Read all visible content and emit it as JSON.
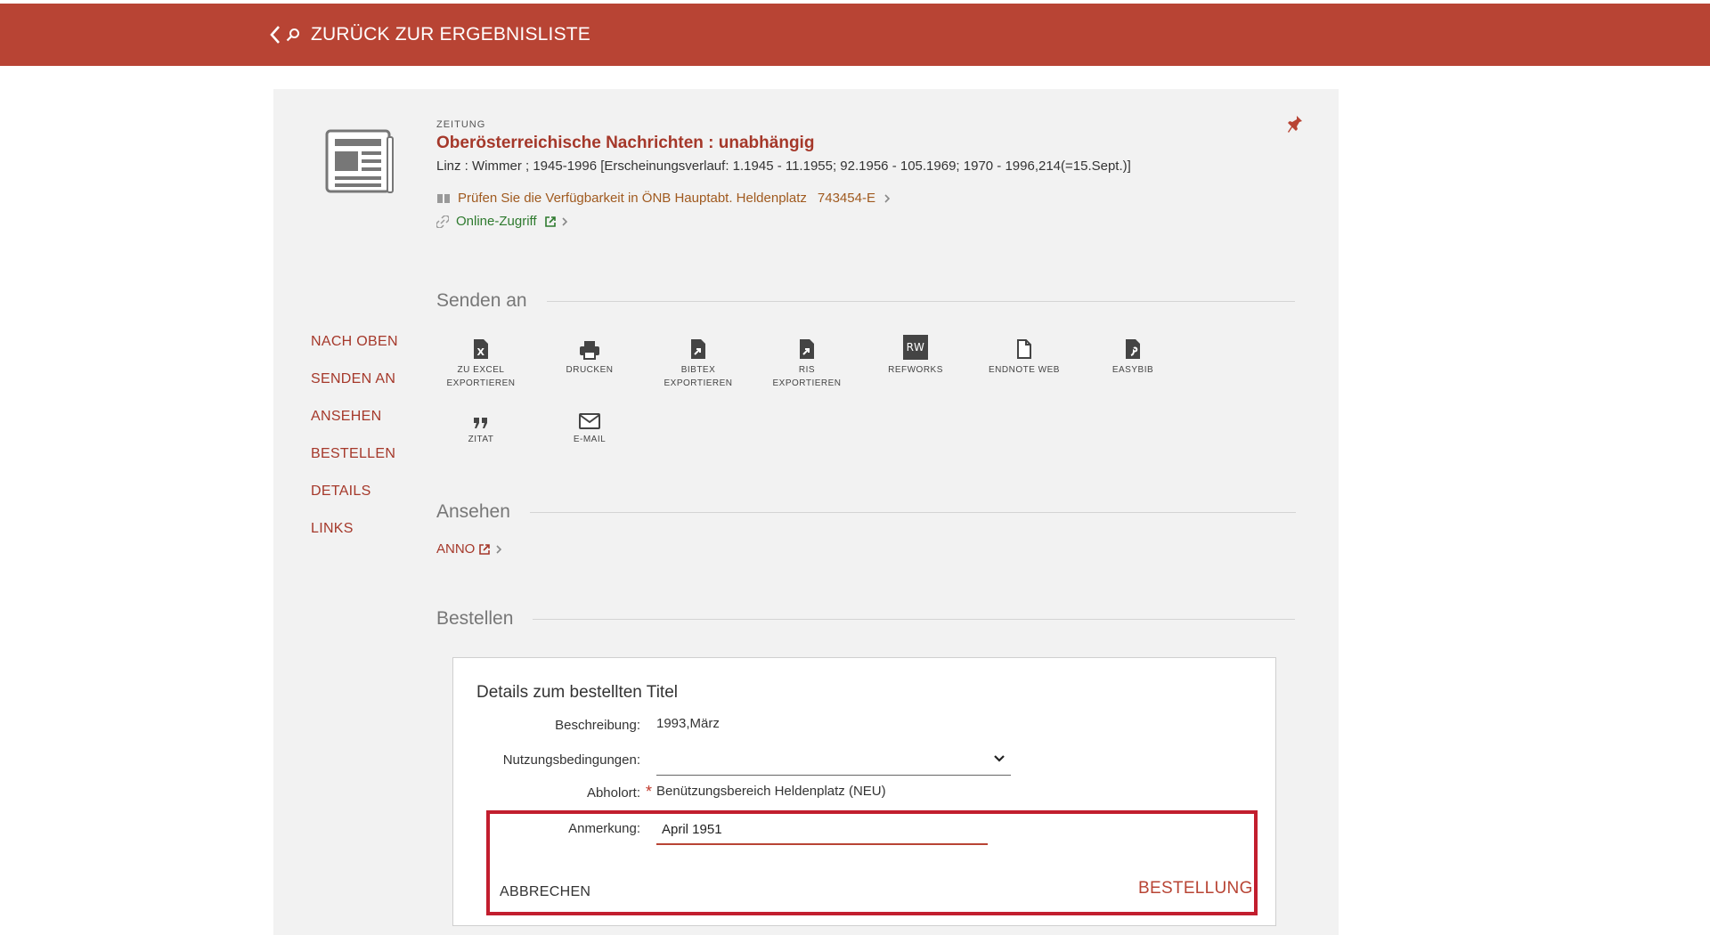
{
  "topbar": {
    "back_label": "ZURÜCK ZUR ERGEBNISLISTE"
  },
  "record": {
    "type": "ZEITUNG",
    "title": "Oberösterreichische Nachrichten : unabhängig",
    "description": "Linz : Wimmer ; 1945-1996 [Erscheinungsverlauf: 1.1945 - 11.1955; 92.1956 - 105.1969; 1970 - 1996,214(=15.Sept.)]",
    "availability_text": "Prüfen Sie die Verfügbarkeit in ÖNB Hauptabt. Heldenplatz",
    "signature": "743454-E",
    "online_access": "Online-Zugriff"
  },
  "sidenav": {
    "items": [
      {
        "label": "NACH OBEN"
      },
      {
        "label": "SENDEN AN"
      },
      {
        "label": "ANSEHEN"
      },
      {
        "label": "BESTELLEN"
      },
      {
        "label": "DETAILS"
      },
      {
        "label": "LINKS"
      }
    ]
  },
  "send_section": {
    "heading": "Senden an",
    "actions": [
      {
        "line1": "ZU EXCEL",
        "line2": "EXPORTIEREN",
        "icon": "excel-export-icon"
      },
      {
        "line1": "DRUCKEN",
        "line2": "",
        "icon": "print-icon"
      },
      {
        "line1": "BIBTEX",
        "line2": "EXPORTIEREN",
        "icon": "bibtex-export-icon"
      },
      {
        "line1": "RIS",
        "line2": "EXPORTIEREN",
        "icon": "ris-export-icon"
      },
      {
        "line1": "REFWORKS",
        "line2": "",
        "icon": "refworks-icon",
        "badge": "RW"
      },
      {
        "line1": "ENDNOTE WEB",
        "line2": "",
        "icon": "endnote-icon"
      },
      {
        "line1": "EASYBIB",
        "line2": "",
        "icon": "easybib-icon"
      },
      {
        "line1": "ZITAT",
        "line2": "",
        "icon": "quote-icon"
      },
      {
        "line1": "E-MAIL",
        "line2": "",
        "icon": "email-icon"
      }
    ]
  },
  "view_section": {
    "heading": "Ansehen",
    "link": "ANNO"
  },
  "order_section": {
    "heading": "Bestellen",
    "box_title": "Details zum bestellten Titel",
    "description_label": "Beschreibung:",
    "description_value": "1993,März",
    "terms_label": "Nutzungsbedingungen:",
    "terms_value": "",
    "pickup_label": "Abholort:",
    "pickup_value": "Benützungsbereich Heldenplatz (NEU)",
    "note_label": "Anmerkung:",
    "note_value": "April 1951",
    "cancel_label": "ABBRECHEN",
    "submit_label": "BESTELLUNG"
  },
  "colors": {
    "brand": "#b84434",
    "highlight": "#c21e2e",
    "online": "#2e7a2e"
  }
}
